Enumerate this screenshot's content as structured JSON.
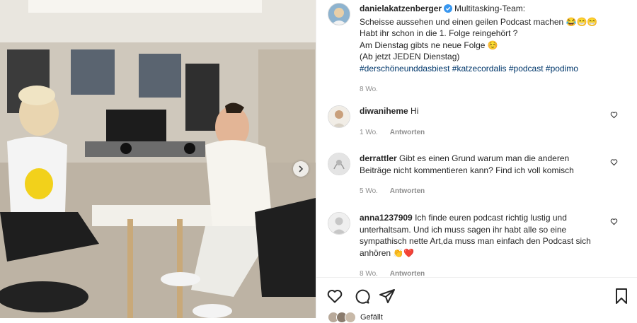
{
  "post": {
    "username": "danielakatzenberger",
    "caption_lines": [
      "Multitasking-Team:",
      "Scheisse aussehen und einen geilen Podcast machen 😂😁😁",
      "Habt ihr schon in die 1. Folge reingehört ?",
      "Am Dienstag gibts ne neue Folge ☺️",
      "(Ab jetzt JEDEN Dienstag)"
    ],
    "hashtags": [
      "#derschöneunddasbiest",
      "#katzecordalis",
      "#podcast",
      "#podimo"
    ],
    "time_ago": "8 Wo."
  },
  "comments": [
    {
      "username": "diwaniheme",
      "text": "Hi",
      "time_ago": "1 Wo.",
      "reply_label": "Antworten"
    },
    {
      "username": "derrattler",
      "text": "Gibt es einen Grund warum man die anderen Beiträge nicht kommentieren kann? Find ich voll komisch",
      "time_ago": "5 Wo.",
      "reply_label": "Antworten"
    },
    {
      "username": "anna1237909",
      "text": "Ich finde euren podcast richtig lustig und unterhaltsam. Und ich muss sagen ihr habt alle so eine sympathisch nette Art,da muss man einfach den Podcast sich anhören 👏❤️",
      "time_ago": "8 Wo.",
      "reply_label": "Antworten"
    }
  ],
  "likes_text": "Gefällt ",
  "likes_rest": "",
  "colors": {
    "link": "#00376b",
    "verified": "#3897f0",
    "muted": "#8e8e8e"
  },
  "icons": [
    "heart-icon",
    "comment-icon",
    "share-icon",
    "bookmark-icon",
    "verified-icon",
    "chevron-right-icon"
  ]
}
